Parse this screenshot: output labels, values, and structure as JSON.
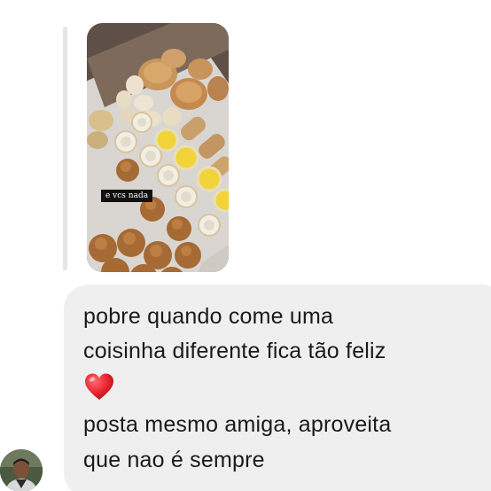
{
  "story": {
    "caption": "e vcs nada"
  },
  "message": {
    "line1": "pobre quando come uma",
    "line2": "coisinha diferente fica tão feliz",
    "emoji": "❤️",
    "line3": "posta mesmo amiga, aproveita",
    "line4": "que nao é sempre"
  },
  "colors": {
    "bubble": "#efefef",
    "heart": "#e8232f",
    "text": "#1a1a1a"
  },
  "icons": {
    "heart": "red-heart-icon"
  }
}
